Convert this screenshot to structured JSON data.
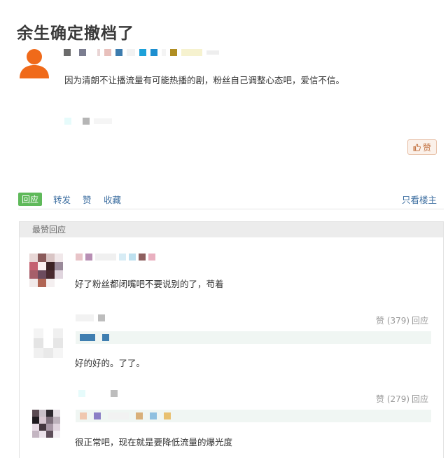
{
  "post": {
    "title": "余生确定撤档了",
    "content": "因为清朗不让播流量有可能热播的剧，粉丝自己调整心态吧，爱信不信。",
    "like_button": "赞"
  },
  "actions": {
    "reply": "回应",
    "repost": "转发",
    "like": "赞",
    "collect": "收藏",
    "only_op": "只看楼主"
  },
  "best_replies": {
    "header": "最赞回应",
    "comments": [
      {
        "text": "好了粉丝都闭嘴吧不要说别的了，苟着"
      },
      {
        "text": "好的好的。了了。",
        "likes": "赞 (379)",
        "reply": "回应"
      },
      {
        "text": "很正常吧，现在就是要降低流量的爆光度",
        "likes": "赞 (279)",
        "reply": "回应"
      }
    ]
  },
  "colors": {
    "avatar": "#f06a1a",
    "reply_button": "#5fb95a",
    "link": "#3c6ea0"
  }
}
